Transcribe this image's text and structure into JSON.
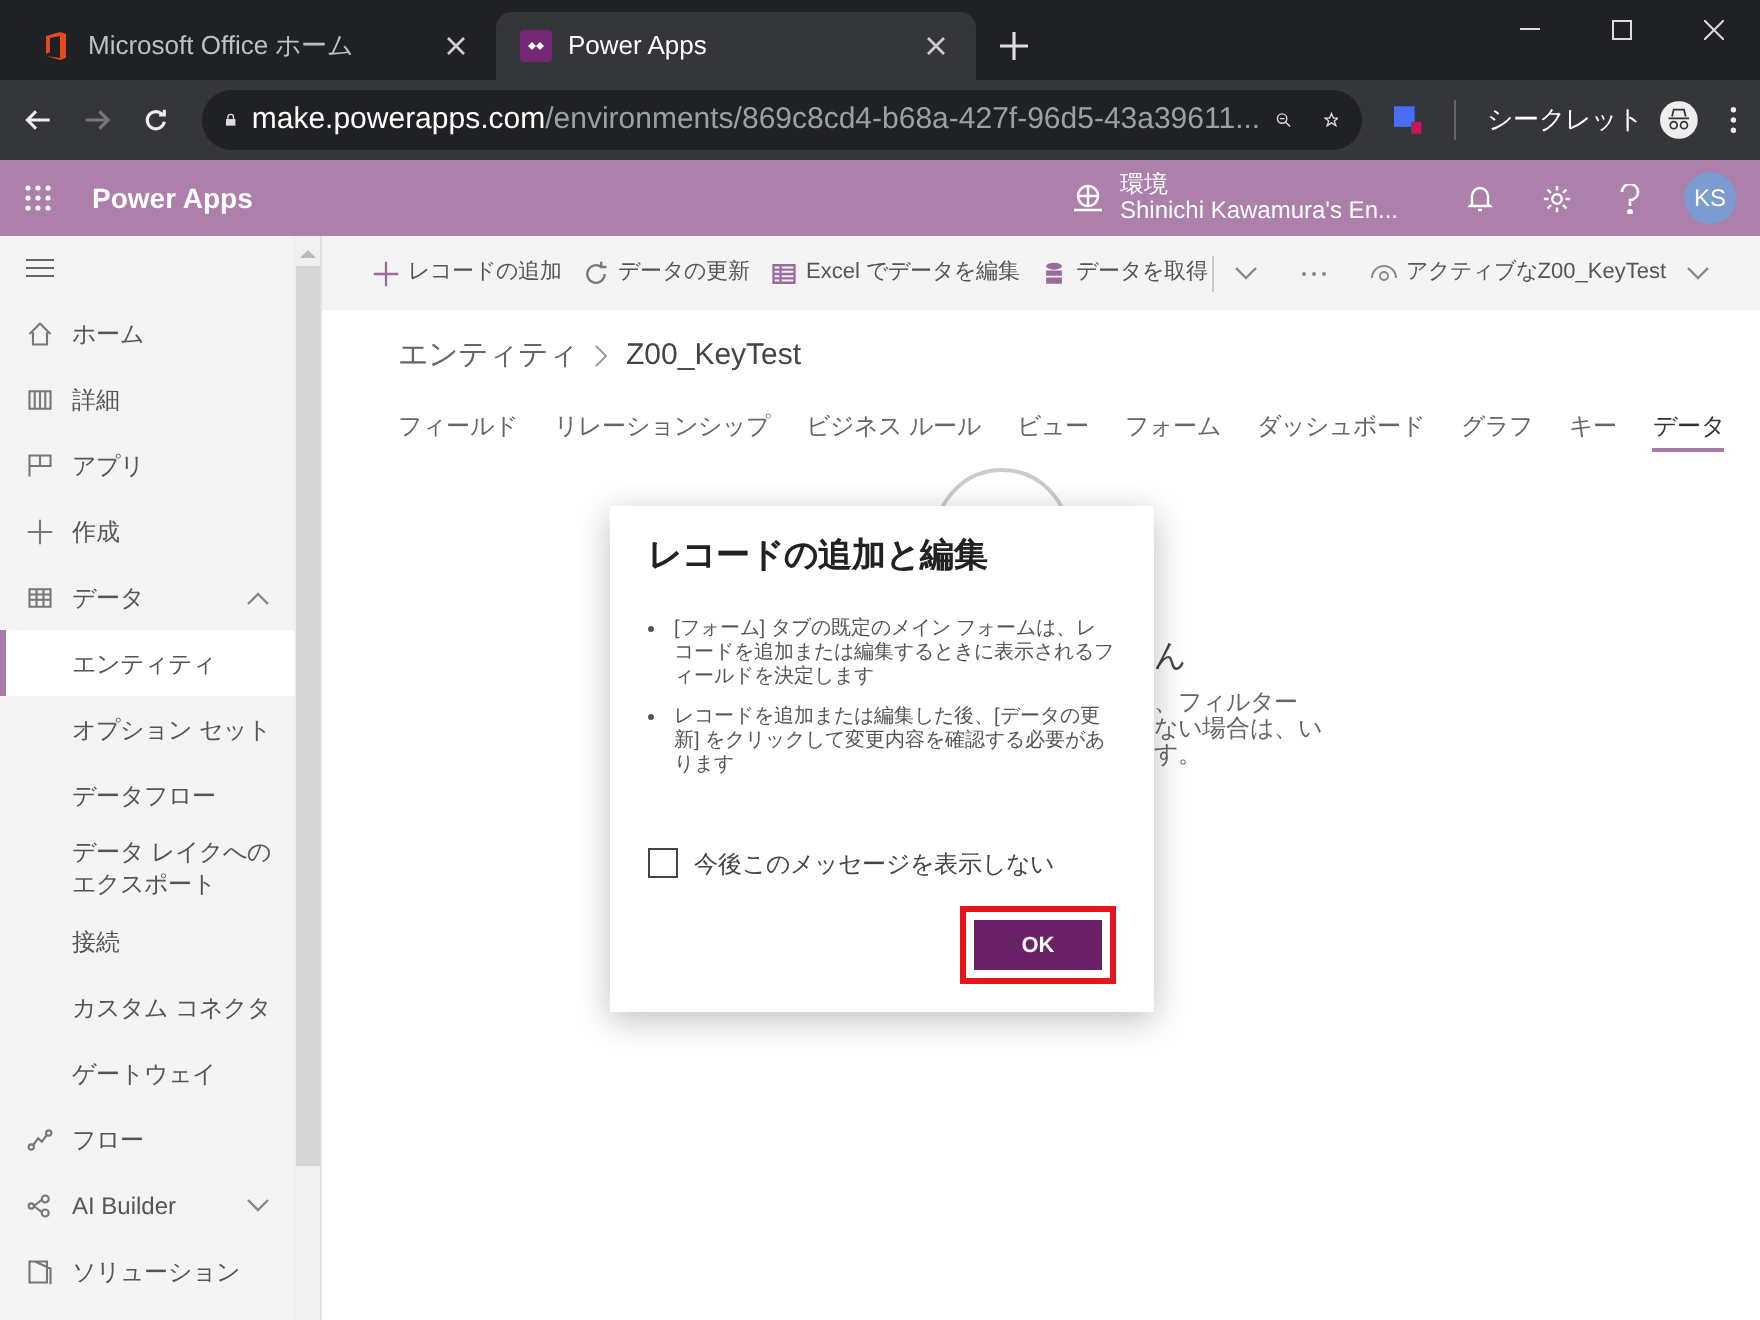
{
  "browser": {
    "tabs": [
      {
        "title": "Microsoft Office ホーム",
        "selected": false,
        "kind": "office"
      },
      {
        "title": "Power Apps",
        "selected": true,
        "kind": "powerapps"
      }
    ],
    "url_host": "make.powerapps.com",
    "url_path": "/environments/869c8cd4-b68a-427f-96d5-43a39611...",
    "profile": "シークレット"
  },
  "app_header": {
    "title": "Power Apps",
    "env_label": "環境",
    "env_name": "Shinichi Kawamura's En...",
    "avatar": "KS"
  },
  "sidebar": {
    "items": [
      {
        "label": "ホーム",
        "kind": "home",
        "selected": false
      },
      {
        "label": "詳細",
        "kind": "book",
        "selected": false
      },
      {
        "label": "アプリ",
        "kind": "apps",
        "selected": false
      },
      {
        "label": "作成",
        "kind": "plus",
        "selected": false
      },
      {
        "label": "データ",
        "kind": "table",
        "selected": false,
        "expanded": true,
        "children": [
          {
            "label": "エンティティ",
            "selected": true
          },
          {
            "label": "オプション セット",
            "selected": false
          },
          {
            "label": "データフロー",
            "selected": false
          },
          {
            "label": "データ レイクへのエクスポート",
            "selected": false
          },
          {
            "label": "接続",
            "selected": false
          },
          {
            "label": "カスタム コネクタ",
            "selected": false
          },
          {
            "label": "ゲートウェイ",
            "selected": false
          }
        ]
      },
      {
        "label": "フロー",
        "kind": "flow",
        "selected": false
      },
      {
        "label": "AI Builder",
        "kind": "ai",
        "selected": false,
        "expanded": false
      },
      {
        "label": "ソリューション",
        "kind": "solution",
        "selected": false
      }
    ]
  },
  "command_bar": {
    "items": [
      {
        "label": "レコードの追加",
        "kind": "plus"
      },
      {
        "label": "データの更新",
        "kind": "refresh"
      },
      {
        "label": "Excel でデータを編集",
        "kind": "excel"
      },
      {
        "label": "データを取得",
        "kind": "db"
      }
    ],
    "view": "アクティブなZ00_KeyTest"
  },
  "breadcrumb": {
    "parent": "エンティティ",
    "current": "Z00_KeyTest"
  },
  "entity_tabs": [
    {
      "label": "フィールド",
      "selected": false
    },
    {
      "label": "リレーションシップ",
      "selected": false
    },
    {
      "label": "ビジネス ルール",
      "selected": false
    },
    {
      "label": "ビュー",
      "selected": false
    },
    {
      "label": "フォーム",
      "selected": false
    },
    {
      "label": "ダッシュボード",
      "selected": false
    },
    {
      "label": "グラフ",
      "selected": false
    },
    {
      "label": "キー",
      "selected": false
    },
    {
      "label": "データ",
      "selected": true
    }
  ],
  "background_fragments": [
    "ん",
    "、フィルター",
    "ない場合は、い",
    "す。"
  ],
  "dialog": {
    "title": "レコードの追加と編集",
    "bullets": [
      "[フォーム] タブの既定のメイン フォームは、レコードを追加または編集するときに表示されるフィールドを決定します",
      "レコードを追加または編集した後、[データの更新] をクリックして変更内容を確認する必要があります"
    ],
    "checkbox": {
      "label": "今後このメッセージを表示しない",
      "checked": false
    },
    "ok": "OK"
  }
}
